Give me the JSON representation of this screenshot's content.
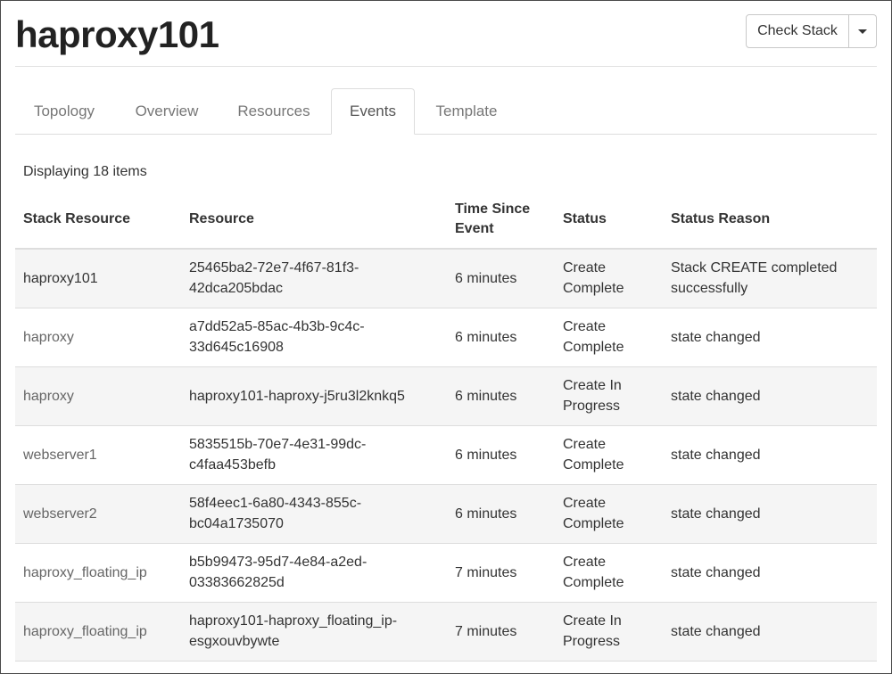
{
  "header": {
    "title": "haproxy101",
    "check_stack_label": "Check Stack",
    "caret_icon": "caret-down-icon"
  },
  "tabs": [
    {
      "label": "Topology",
      "active": false
    },
    {
      "label": "Overview",
      "active": false
    },
    {
      "label": "Resources",
      "active": false
    },
    {
      "label": "Events",
      "active": true
    },
    {
      "label": "Template",
      "active": false
    }
  ],
  "table": {
    "count_text": "Displaying 18 items",
    "columns": [
      "Stack Resource",
      "Resource",
      "Time Since Event",
      "Status",
      "Status Reason"
    ],
    "rows": [
      {
        "stack_resource": "haproxy101",
        "resource": "25465ba2-72e7-4f67-81f3-42dca205bdac",
        "time": "6 minutes",
        "status": "Create Complete",
        "reason": "Stack CREATE completed successfully"
      },
      {
        "stack_resource": "haproxy",
        "resource": "a7dd52a5-85ac-4b3b-9c4c-33d645c16908",
        "time": "6 minutes",
        "status": "Create Complete",
        "reason": "state changed"
      },
      {
        "stack_resource": "haproxy",
        "resource": "haproxy101-haproxy-j5ru3l2knkq5",
        "time": "6 minutes",
        "status": "Create In Progress",
        "reason": "state changed"
      },
      {
        "stack_resource": "webserver1",
        "resource": "5835515b-70e7-4e31-99dc-c4faa453befb",
        "time": "6 minutes",
        "status": "Create Complete",
        "reason": "state changed"
      },
      {
        "stack_resource": "webserver2",
        "resource": "58f4eec1-6a80-4343-855c-bc04a1735070",
        "time": "6 minutes",
        "status": "Create Complete",
        "reason": "state changed"
      },
      {
        "stack_resource": "haproxy_floating_ip",
        "resource": "b5b99473-95d7-4e84-a2ed-03383662825d",
        "time": "7 minutes",
        "status": "Create Complete",
        "reason": "state changed"
      },
      {
        "stack_resource": "haproxy_floating_ip",
        "resource": "haproxy101-haproxy_floating_ip-esgxouvbywte",
        "time": "7 minutes",
        "status": "Create In Progress",
        "reason": "state changed"
      }
    ]
  }
}
